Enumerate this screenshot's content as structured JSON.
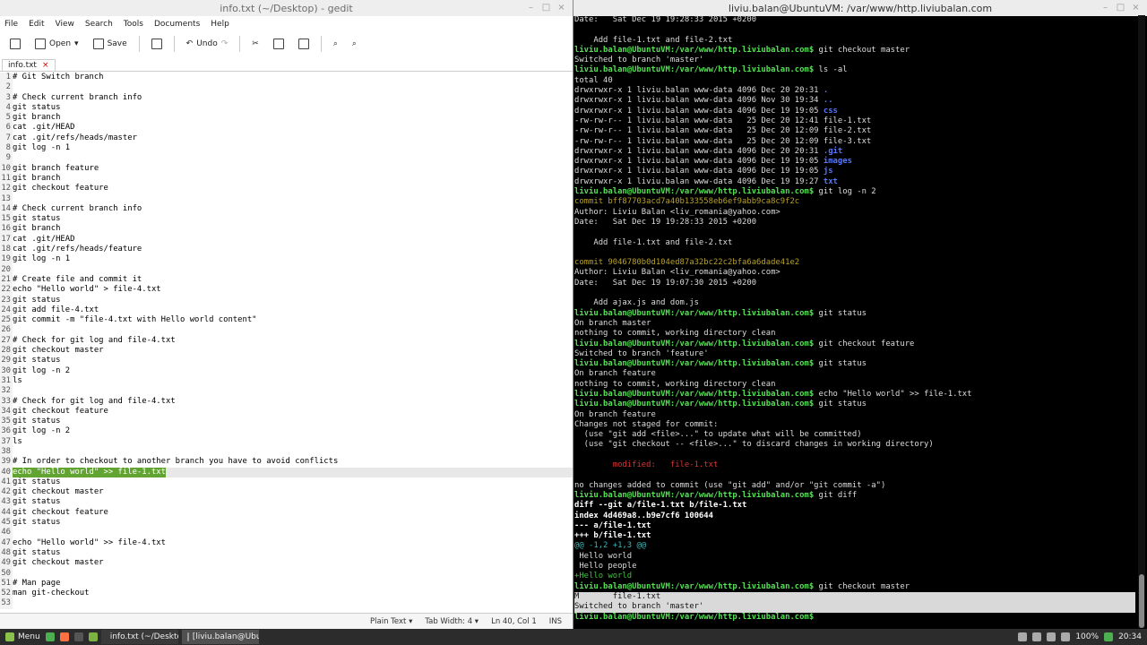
{
  "gedit": {
    "title": "info.txt (~/Desktop) - gedit",
    "menu": [
      "File",
      "Edit",
      "View",
      "Search",
      "Tools",
      "Documents",
      "Help"
    ],
    "toolbar": {
      "open": "Open",
      "save": "Save",
      "undo": "Undo"
    },
    "tab": {
      "label": "info.txt",
      "close": "×"
    },
    "status": {
      "lang": "Plain Text",
      "tabwidth": "Tab Width: 4",
      "pos": "Ln 40, Col 1",
      "mode": "INS"
    },
    "lines": [
      "# Git Switch branch",
      "",
      "# Check current branch info",
      "git status",
      "git branch",
      "cat .git/HEAD",
      "cat .git/refs/heads/master",
      "git log -n 1",
      "",
      "git branch feature",
      "git branch",
      "git checkout feature",
      "",
      "# Check current branch info",
      "git status",
      "git branch",
      "cat .git/HEAD",
      "cat .git/refs/heads/feature",
      "git log -n 1",
      "",
      "# Create file and commit it",
      "echo \"Hello world\" > file-4.txt",
      "git status",
      "git add file-4.txt",
      "git commit -m \"file-4.txt with Hello world content\"",
      "",
      "# Check for git log and file-4.txt",
      "git checkout master",
      "git status",
      "git log -n 2",
      "ls",
      "",
      "# Check for git log and file-4.txt",
      "git checkout feature",
      "git status",
      "git log -n 2",
      "ls",
      "",
      "# In order to checkout to another branch you have to avoid conflicts",
      "echo \"Hello world\" >> file-1.txt",
      "git status",
      "git checkout master",
      "git status",
      "git checkout feature",
      "git status",
      "",
      "echo \"Hello world\" >> file-4.txt",
      "git status",
      "git checkout master",
      "",
      "# Man page",
      "man git-checkout",
      ""
    ]
  },
  "terminal": {
    "title": "liviu.balan@UbuntuVM: /var/www/http.liviubalan.com",
    "prompt": "liviu.balan@UbuntuVM",
    "path": ":/var/www/http.liviubalan.com$",
    "lines": [
      {
        "t": "Date:   Sat Dec 19 19:28:33 2015 +0200"
      },
      {
        "t": ""
      },
      {
        "t": "    Add file-1.txt and file-2.txt"
      },
      {
        "p": 1,
        "t": " git checkout master"
      },
      {
        "t": "Switched to branch 'master'"
      },
      {
        "p": 1,
        "t": " ls -al"
      },
      {
        "t": "total 40"
      },
      {
        "t": "drwxrwxr-x 1 liviu.balan www-data 4096 Dec 20 20:31 ",
        "d": "."
      },
      {
        "t": "drwxrwxr-x 1 liviu.balan www-data 4096 Nov 30 19:34 ",
        "d": ".."
      },
      {
        "t": "drwxrwxr-x 1 liviu.balan www-data 4096 Dec 19 19:05 ",
        "d": "css"
      },
      {
        "t": "-rw-rw-r-- 1 liviu.balan www-data   25 Dec 20 12:41 file-1.txt"
      },
      {
        "t": "-rw-rw-r-- 1 liviu.balan www-data   25 Dec 20 12:09 file-2.txt"
      },
      {
        "t": "-rw-rw-r-- 1 liviu.balan www-data   25 Dec 20 12:09 file-3.txt"
      },
      {
        "t": "drwxrwxr-x 1 liviu.balan www-data 4096 Dec 20 20:31 ",
        "d": ".git"
      },
      {
        "t": "drwxrwxr-x 1 liviu.balan www-data 4096 Dec 19 19:05 ",
        "d": "images"
      },
      {
        "t": "drwxrwxr-x 1 liviu.balan www-data 4096 Dec 19 19:05 ",
        "d": "js"
      },
      {
        "t": "drwxrwxr-x 1 liviu.balan www-data 4096 Dec 19 19:27 ",
        "d": "txt"
      },
      {
        "p": 1,
        "t": " git log -n 2"
      },
      {
        "t": "commit bff87703acd7a40b133558eb6ef9abb9ca8c9f2c",
        "cls": "y"
      },
      {
        "t": "Author: Liviu Balan <liv_romania@yahoo.com>"
      },
      {
        "t": "Date:   Sat Dec 19 19:28:33 2015 +0200"
      },
      {
        "t": ""
      },
      {
        "t": "    Add file-1.txt and file-2.txt"
      },
      {
        "t": ""
      },
      {
        "t": "commit 9046780b0d104ed87a32bc22c2bfa6a6dade41e2",
        "cls": "y"
      },
      {
        "t": "Author: Liviu Balan <liv_romania@yahoo.com>"
      },
      {
        "t": "Date:   Sat Dec 19 19:07:30 2015 +0200"
      },
      {
        "t": ""
      },
      {
        "t": "    Add ajax.js and dom.js"
      },
      {
        "p": 1,
        "t": " git status"
      },
      {
        "t": "On branch master"
      },
      {
        "t": "nothing to commit, working directory clean"
      },
      {
        "p": 1,
        "t": " git checkout feature"
      },
      {
        "t": "Switched to branch 'feature'"
      },
      {
        "p": 1,
        "t": " git status"
      },
      {
        "t": "On branch feature"
      },
      {
        "t": "nothing to commit, working directory clean"
      },
      {
        "p": 1,
        "t": " echo \"Hello world\" >> file-1.txt"
      },
      {
        "p": 1,
        "t": " git status"
      },
      {
        "t": "On branch feature"
      },
      {
        "t": "Changes not staged for commit:"
      },
      {
        "t": "  (use \"git add <file>...\" to update what will be committed)"
      },
      {
        "t": "  (use \"git checkout -- <file>...\" to discard changes in working directory)"
      },
      {
        "t": ""
      },
      {
        "t": "        modified:   file-1.txt",
        "cls": "r"
      },
      {
        "t": ""
      },
      {
        "t": "no changes added to commit (use \"git add\" and/or \"git commit -a\")"
      },
      {
        "p": 1,
        "t": " git diff"
      },
      {
        "t": "diff --git a/file-1.txt b/file-1.txt",
        "cls": "w"
      },
      {
        "t": "index 4d469a8..b9e7cf6 100644",
        "cls": "w"
      },
      {
        "t": "--- a/file-1.txt",
        "cls": "w"
      },
      {
        "t": "+++ b/file-1.txt",
        "cls": "w"
      },
      {
        "t": "@@ -1,2 +1,3 @@",
        "cls": "c"
      },
      {
        "t": " Hello world"
      },
      {
        "t": " Hello people"
      },
      {
        "t": "+Hello world",
        "cls": "gr"
      },
      {
        "p": 1,
        "t": " git checkout master"
      },
      {
        "t": "M       file-1.txt",
        "cls": "hl"
      },
      {
        "t": "Switched to branch 'master'",
        "cls": "hl"
      },
      {
        "p": 1,
        "t": " "
      }
    ]
  },
  "taskbar": {
    "menu": "Menu",
    "task1": "info.txt (~/Desktop) ...",
    "task2": "[liviu.balan@Ubuntu...",
    "battery": "100%",
    "time": "20:34"
  }
}
